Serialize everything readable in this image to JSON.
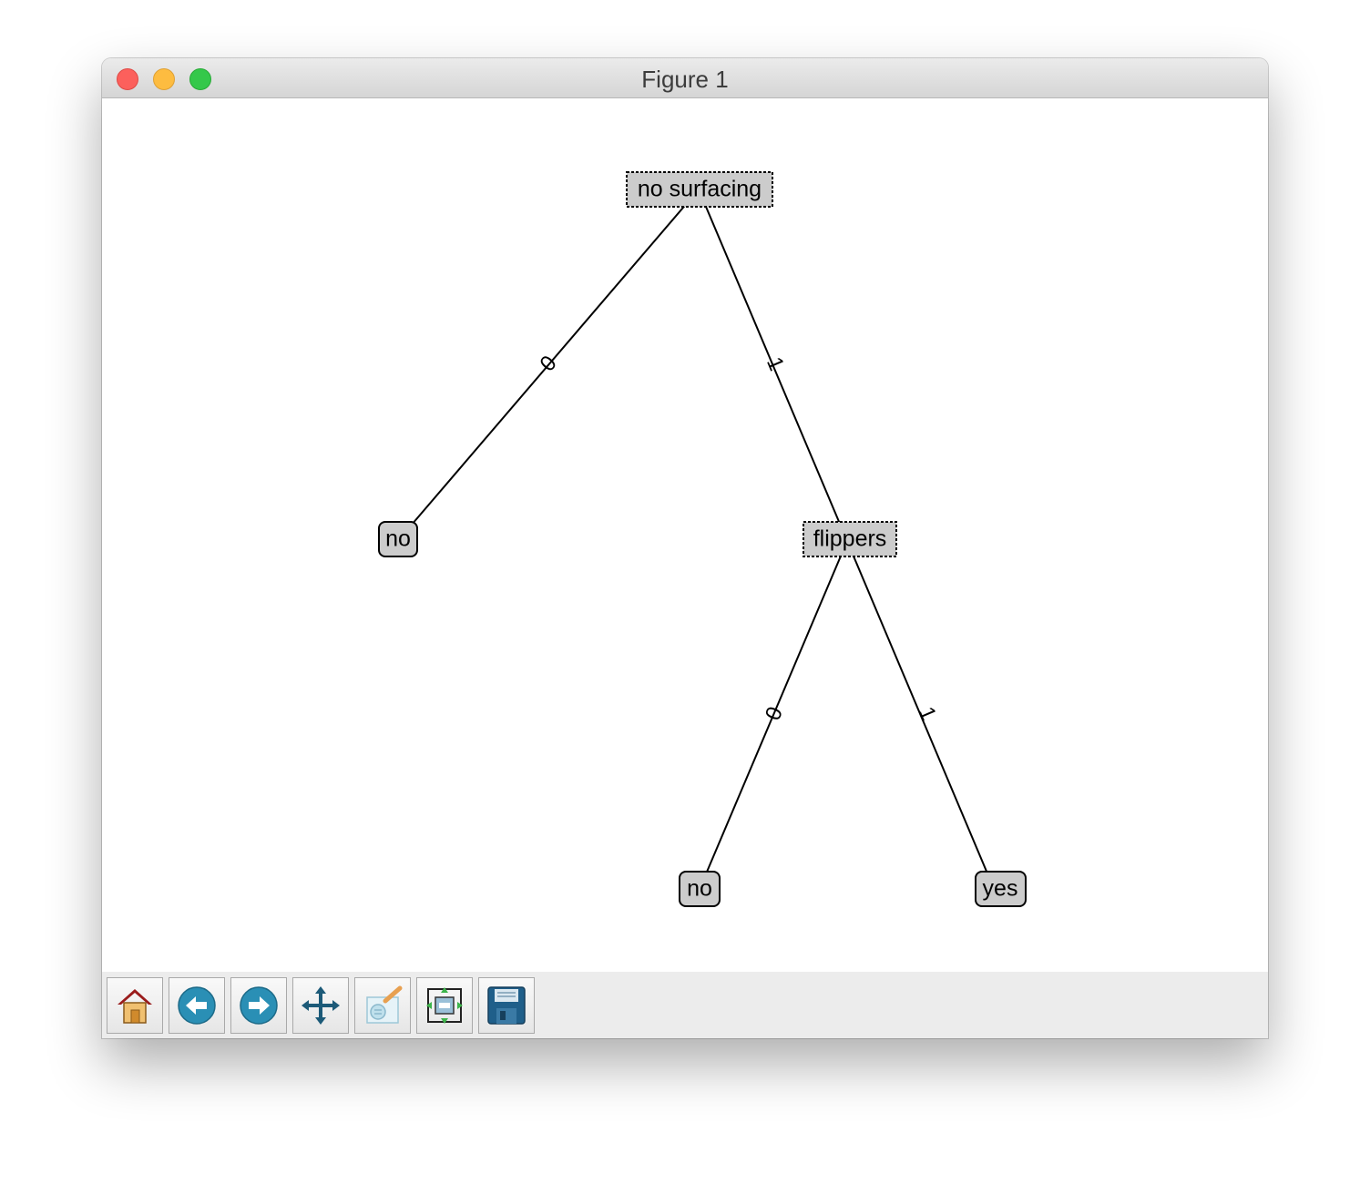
{
  "window": {
    "title": "Figure 1"
  },
  "tree": {
    "root": {
      "label": "no surfacing",
      "style": "decision"
    },
    "nodes": [
      {
        "id": "leaf-no-1",
        "label": "no",
        "style": "leaf"
      },
      {
        "id": "decision-flippers",
        "label": "flippers",
        "style": "decision"
      },
      {
        "id": "leaf-no-2",
        "label": "no",
        "style": "leaf"
      },
      {
        "id": "leaf-yes",
        "label": "yes",
        "style": "leaf"
      }
    ],
    "edges": [
      {
        "from": "no surfacing",
        "to": "no",
        "label": "0"
      },
      {
        "from": "no surfacing",
        "to": "flippers",
        "label": "1"
      },
      {
        "from": "flippers",
        "to": "no",
        "label": "0"
      },
      {
        "from": "flippers",
        "to": "yes",
        "label": "1"
      }
    ],
    "colors": {
      "node_fill": "#cccccc",
      "line": "#000000"
    }
  },
  "toolbar": {
    "buttons": [
      {
        "name": "home",
        "icon": "home-icon"
      },
      {
        "name": "back",
        "icon": "back-arrow-icon"
      },
      {
        "name": "forward",
        "icon": "forward-arrow-icon"
      },
      {
        "name": "pan",
        "icon": "move-icon"
      },
      {
        "name": "zoom",
        "icon": "zoom-to-rect-icon"
      },
      {
        "name": "subplots",
        "icon": "subplots-icon"
      },
      {
        "name": "save",
        "icon": "save-icon"
      }
    ]
  }
}
